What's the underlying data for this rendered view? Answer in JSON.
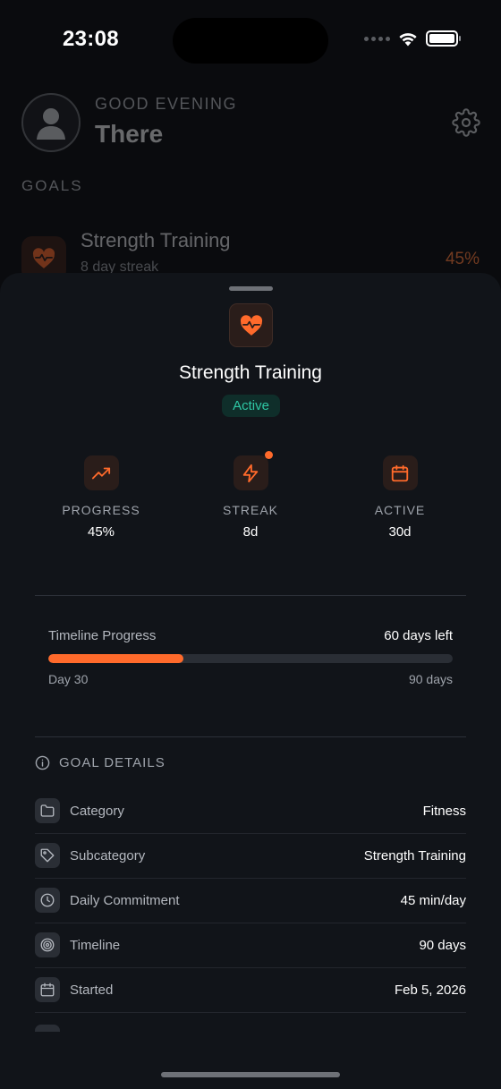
{
  "status_bar": {
    "time": "23:08"
  },
  "background": {
    "greeting": "GOOD EVENING",
    "username": "There",
    "goals_label": "GOALS",
    "goal": {
      "name": "Strength Training",
      "streak": "8 day streak",
      "percent": "45%"
    }
  },
  "sheet": {
    "title": "Strength Training",
    "status": "Active",
    "stats": [
      {
        "label": "PROGRESS",
        "value": "45%",
        "icon": "trending-up-icon"
      },
      {
        "label": "STREAK",
        "value": "8d",
        "icon": "lightning-icon"
      },
      {
        "label": "ACTIVE",
        "value": "30d",
        "icon": "calendar-icon"
      }
    ],
    "timeline": {
      "label": "Timeline Progress",
      "remaining": "60 days left",
      "start": "Day 30",
      "end": "90 days",
      "progress_fraction": 0.333
    },
    "details_header": "GOAL DETAILS",
    "details": [
      {
        "label": "Category",
        "value": "Fitness",
        "icon": "folder-icon"
      },
      {
        "label": "Subcategory",
        "value": "Strength Training",
        "icon": "tag-icon"
      },
      {
        "label": "Daily Commitment",
        "value": "45 min/day",
        "icon": "clock-icon"
      },
      {
        "label": "Timeline",
        "value": "90 days",
        "icon": "target-icon"
      },
      {
        "label": "Started",
        "value": "Feb 5, 2026",
        "icon": "calendar-icon"
      }
    ]
  },
  "colors": {
    "accent": "#ff6a2b",
    "active": "#2ec7a4",
    "sheet_bg": "#111419"
  }
}
